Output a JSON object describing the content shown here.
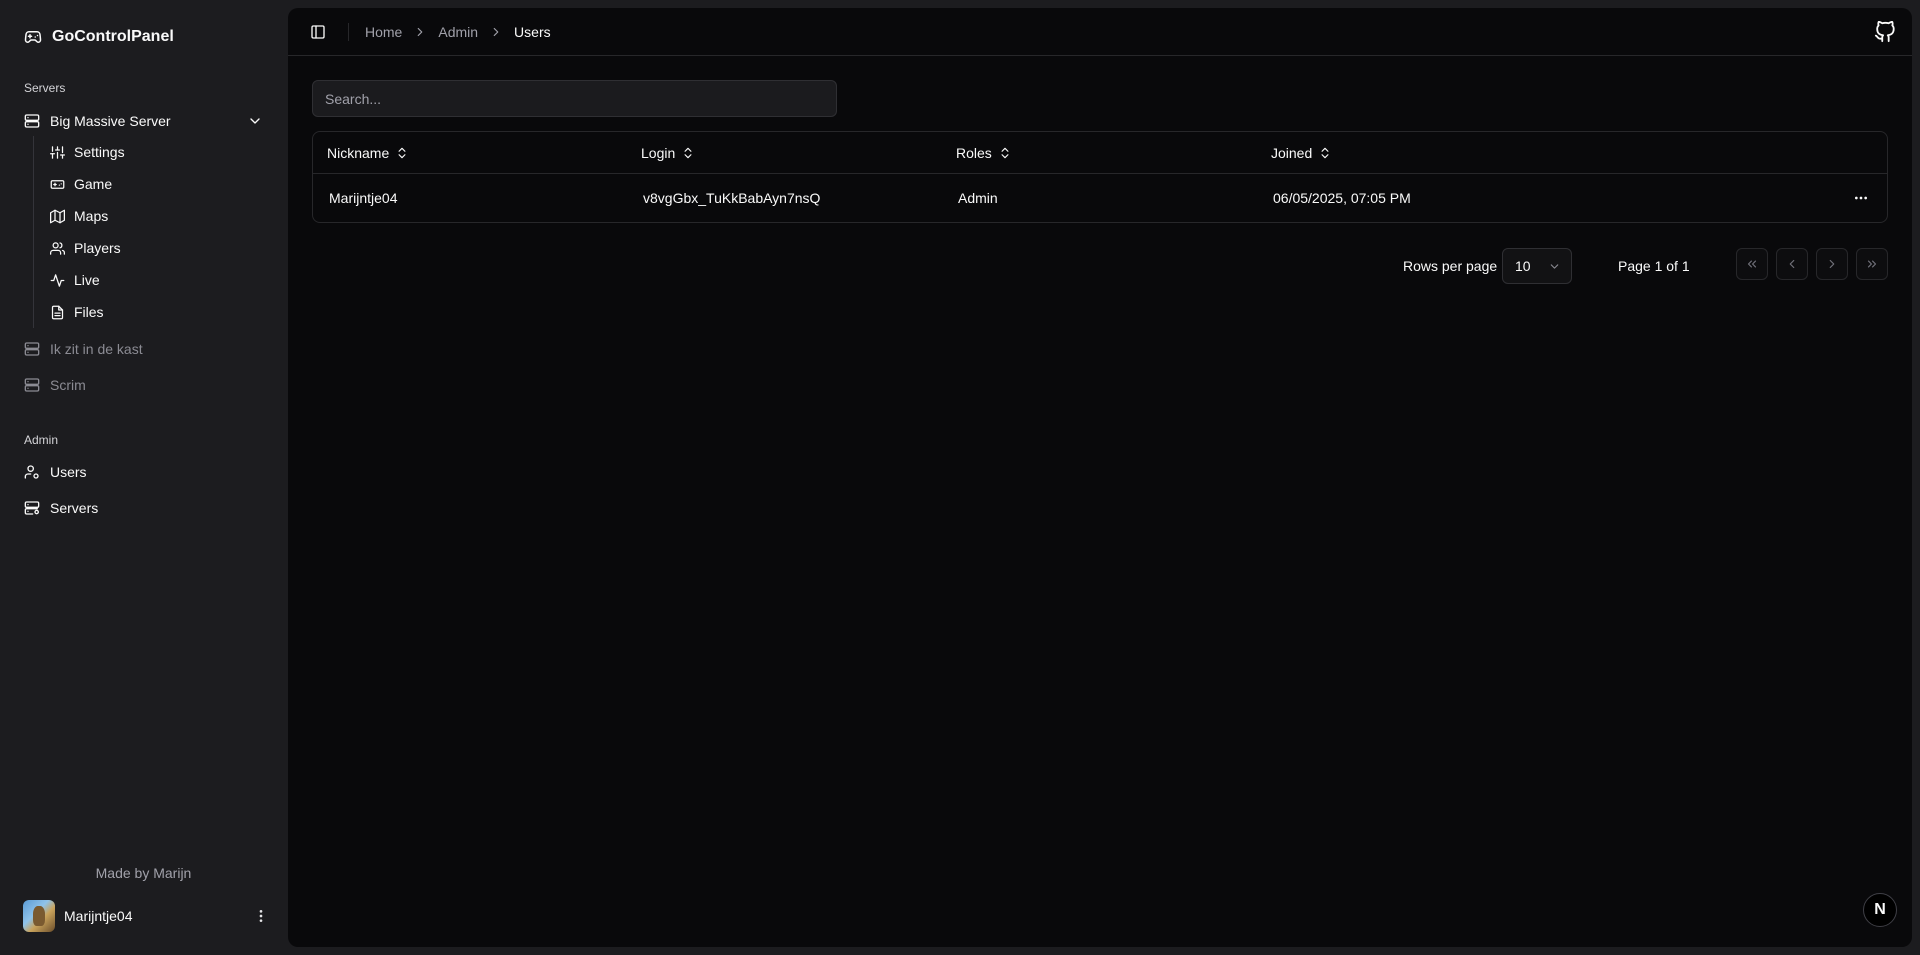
{
  "app": {
    "name": "GoControlPanel"
  },
  "sidebar": {
    "servers_label": "Servers",
    "servers": [
      {
        "label": "Big Massive Server",
        "icon": "server-icon",
        "expanded": true
      },
      {
        "label": "Ik zit in de kast",
        "icon": "server-icon",
        "disabled": true
      },
      {
        "label": "Scrim",
        "icon": "server-icon",
        "disabled": true
      }
    ],
    "sub_items": [
      {
        "label": "Settings",
        "icon": "sliders-icon"
      },
      {
        "label": "Game",
        "icon": "gamepad-icon"
      },
      {
        "label": "Maps",
        "icon": "map-icon"
      },
      {
        "label": "Players",
        "icon": "users-icon"
      },
      {
        "label": "Live",
        "icon": "activity-icon"
      },
      {
        "label": "Files",
        "icon": "file-icon"
      }
    ],
    "admin_label": "Admin",
    "admin_items": [
      {
        "label": "Users",
        "icon": "user-cog-icon"
      },
      {
        "label": "Servers",
        "icon": "server-cog-icon"
      }
    ],
    "footer": "Made by Marijn",
    "user": {
      "name": "Marijntje04"
    }
  },
  "header": {
    "breadcrumb": [
      "Home",
      "Admin",
      "Users"
    ]
  },
  "search": {
    "placeholder": "Search...",
    "value": ""
  },
  "table": {
    "columns": [
      "Nickname",
      "Login",
      "Roles",
      "Joined"
    ],
    "rows": [
      {
        "nickname": "Marijntje04",
        "login": "v8vgGbx_TuKkBabAyn7nsQ",
        "roles": "Admin",
        "joined": "06/05/2025, 07:05 PM"
      }
    ]
  },
  "pagination": {
    "rows_per_page_label": "Rows per page",
    "rows_per_page": "10",
    "page_label": "Page 1 of 1"
  },
  "badge": {
    "letter": "N"
  },
  "colors": {
    "sidebar_bg": "#1c1c1f",
    "main_bg": "#09090b",
    "border": "#27272a",
    "muted_text": "#a1a1aa"
  }
}
